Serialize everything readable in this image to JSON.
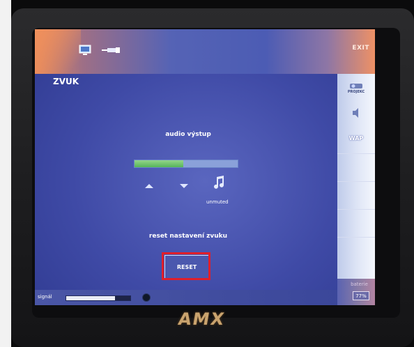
{
  "header": {
    "exit_label": "EXIT",
    "monitor_icon": "monitor-icon",
    "cable_icon": "cable-icon"
  },
  "page": {
    "title": "ZVUK"
  },
  "sidebar": {
    "items": [
      {
        "label": "PROJEKC",
        "icon": "projector-icon"
      },
      {
        "label": "",
        "icon": "speaker-icon"
      },
      {
        "label": "WAP",
        "icon": "wap-icon"
      },
      {
        "label": "",
        "icon": ""
      },
      {
        "label": "",
        "icon": ""
      },
      {
        "label": "",
        "icon": ""
      },
      {
        "label": "",
        "icon": ""
      }
    ]
  },
  "audio": {
    "output_label": "audio výstup",
    "level_fraction": 0.47,
    "mute_status": "unmuted",
    "up_icon": "volume-up-icon",
    "down_icon": "volume-down-icon",
    "note_icon": "music-note-icon"
  },
  "reset": {
    "label": "reset nastavení zvuku",
    "button_label": "RESET"
  },
  "status": {
    "signal_label": "signál",
    "signal_fraction": 0.76,
    "battery_label": "baterie",
    "battery_value": "77%"
  },
  "brand": {
    "logo_text": "AMX"
  },
  "colors": {
    "highlight_red": "#e01f2a",
    "level_green": "#56b45a",
    "screen_blue": "#3f4aa6"
  }
}
